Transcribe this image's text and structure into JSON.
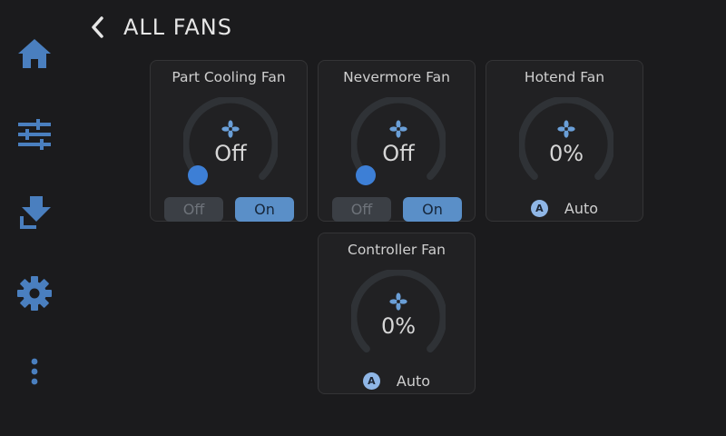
{
  "header": {
    "title": "ALL FANS"
  },
  "sidebar": {
    "items": [
      {
        "icon": "home-icon"
      },
      {
        "icon": "sliders-icon"
      },
      {
        "icon": "filament-icon"
      },
      {
        "icon": "gear-icon"
      },
      {
        "icon": "more-vertical-icon"
      }
    ]
  },
  "colors": {
    "accent": "#3d7fd6",
    "icon": "#4a7fbf",
    "toggle_on": "#5a8fc8",
    "toggle_off": "#3b3f45",
    "card_bg": "#212123"
  },
  "fans": [
    {
      "name": "Part Cooling Fan",
      "value": "Off",
      "level": 0,
      "off_label": "Off",
      "on_label": "On"
    },
    {
      "name": "Nevermore Fan",
      "value": "Off",
      "level": 0,
      "off_label": "Off",
      "on_label": "On"
    },
    {
      "name": "Hotend Fan",
      "value": "0%",
      "level": 0,
      "badge": "A",
      "mode_label": "Auto"
    },
    {
      "name": "Controller Fan",
      "value": "0%",
      "level": 0,
      "badge": "A",
      "mode_label": "Auto"
    }
  ]
}
